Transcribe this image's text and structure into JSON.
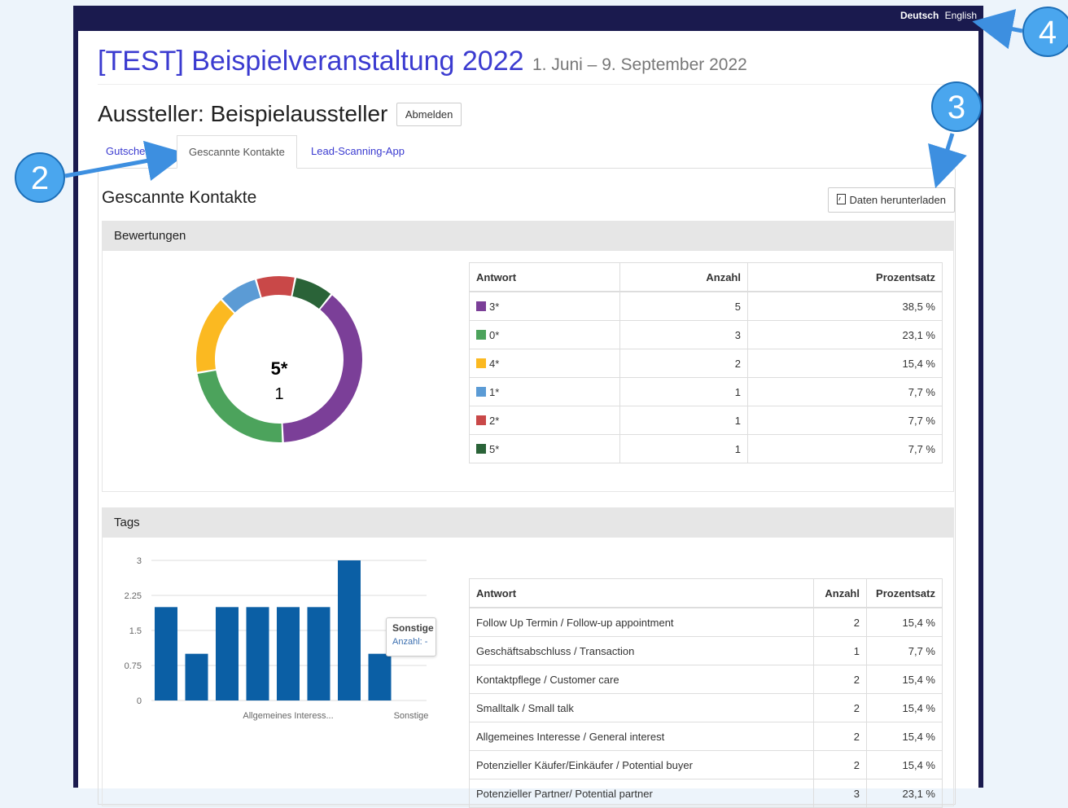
{
  "lang": {
    "deutsch": "Deutsch",
    "english": "English"
  },
  "event": {
    "title": "[TEST] Beispielveranstaltung 2022",
    "dates": "1. Juni – 9. September 2022"
  },
  "exhibitor": {
    "heading": "Aussteller: Beispielaussteller",
    "logout": "Abmelden"
  },
  "tabs": [
    {
      "label": "Gutschein"
    },
    {
      "label": "Gescannte Kontakte"
    },
    {
      "label": "Lead-Scanning-App"
    }
  ],
  "panel": {
    "title": "Gescannte Kontakte",
    "download": "Daten herunterladen"
  },
  "ratings": {
    "heading": "Bewertungen",
    "center_label": "5*",
    "center_value": "1",
    "columns": [
      "Antwort",
      "Anzahl",
      "Prozentsatz"
    ],
    "rows": [
      {
        "answer": "3*",
        "count": "5",
        "percent": "38,5 %",
        "color": "#7b3f98"
      },
      {
        "answer": "0*",
        "count": "3",
        "percent": "23,1 %",
        "color": "#4ca35c"
      },
      {
        "answer": "4*",
        "count": "2",
        "percent": "15,4 %",
        "color": "#fbb921"
      },
      {
        "answer": "1*",
        "count": "1",
        "percent": "7,7 %",
        "color": "#5b9bd5"
      },
      {
        "answer": "2*",
        "count": "1",
        "percent": "7,7 %",
        "color": "#c94848"
      },
      {
        "answer": "5*",
        "count": "1",
        "percent": "7,7 %",
        "color": "#2a6338"
      }
    ]
  },
  "tags": {
    "heading": "Tags",
    "columns": [
      "Antwort",
      "Anzahl",
      "Prozentsatz"
    ],
    "rows": [
      {
        "answer": "Follow Up Termin / Follow-up appointment",
        "count": "2",
        "percent": "15,4 %"
      },
      {
        "answer": "Geschäftsabschluss / Transaction",
        "count": "1",
        "percent": "7,7 %"
      },
      {
        "answer": "Kontaktpflege / Customer care",
        "count": "2",
        "percent": "15,4 %"
      },
      {
        "answer": "Smalltalk / Small talk",
        "count": "2",
        "percent": "15,4 %"
      },
      {
        "answer": "Allgemeines Interesse / General interest",
        "count": "2",
        "percent": "15,4 %"
      },
      {
        "answer": "Potenzieller Käufer/Einkäufer / Potential buyer",
        "count": "2",
        "percent": "15,4 %"
      },
      {
        "answer": "Potenzieller Partner/ Potential partner",
        "count": "3",
        "percent": "23,1 %"
      }
    ],
    "tooltip": {
      "title": "Sonstige",
      "line": "Anzahl: -"
    }
  },
  "chart_data": [
    {
      "type": "pie",
      "labels": [
        "3*",
        "0*",
        "4*",
        "1*",
        "2*",
        "5*"
      ],
      "values": [
        5,
        3,
        2,
        1,
        1,
        1
      ],
      "colors": [
        "#7b3f98",
        "#4ca35c",
        "#fbb921",
        "#5b9bd5",
        "#c94848",
        "#2a6338"
      ],
      "donut": true
    },
    {
      "type": "bar",
      "values": [
        2,
        1,
        2,
        2,
        2,
        2,
        3,
        1
      ],
      "visible_category_labels": [
        "Allgemeines Interess...",
        "Sonstige"
      ],
      "yticks": [
        "3",
        "2.25",
        "1.5",
        "0.75",
        "0"
      ],
      "ylim": [
        0,
        3
      ],
      "color": "#0b5fa5",
      "grid": true
    }
  ],
  "callouts": [
    "2",
    "3",
    "4"
  ]
}
